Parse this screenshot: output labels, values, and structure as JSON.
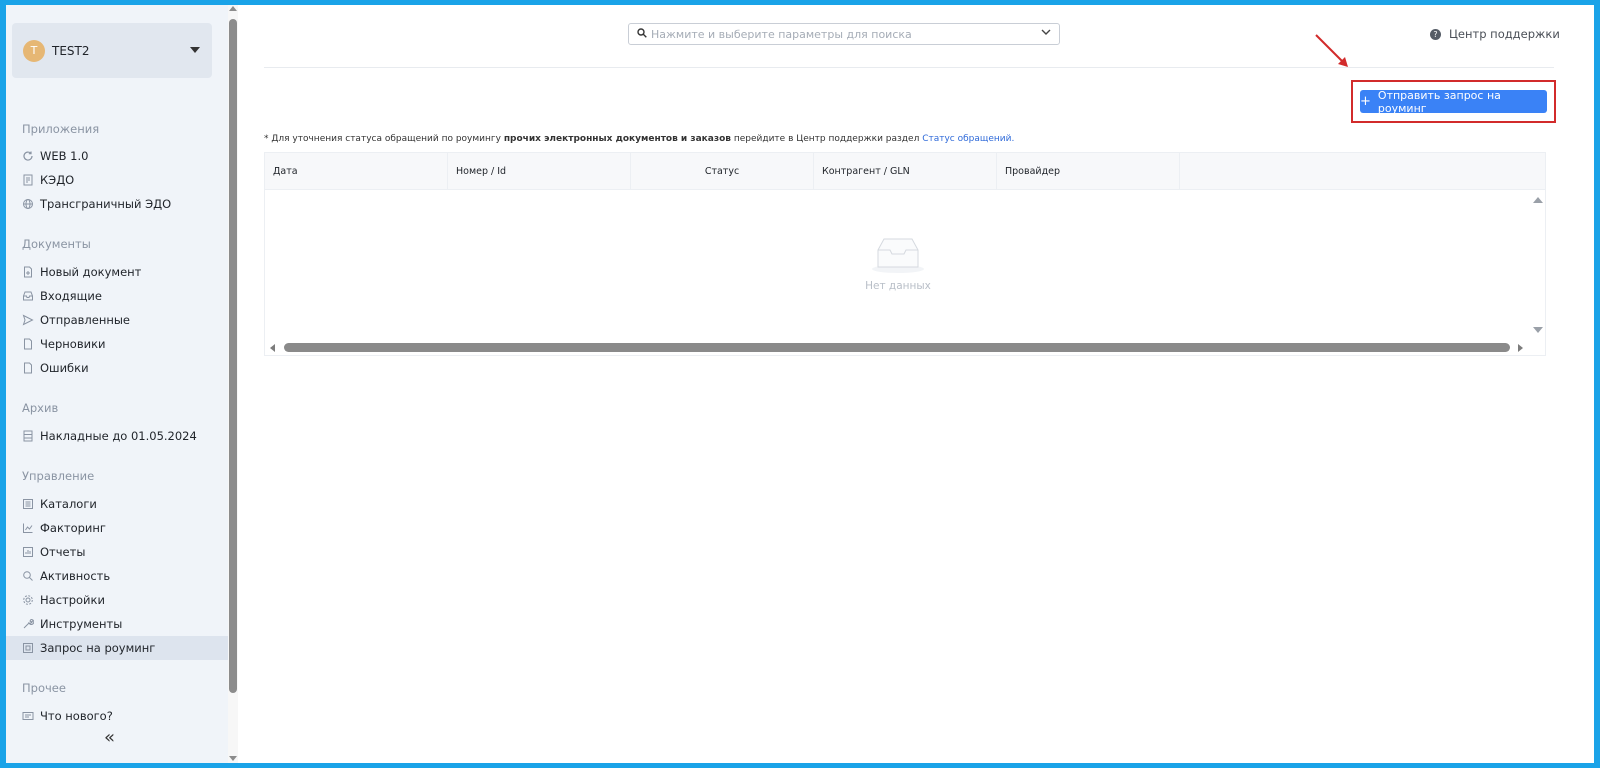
{
  "account": {
    "initial": "T",
    "name": "TEST2",
    "avatar_color": "#e6b774"
  },
  "sidebar": {
    "sections": [
      {
        "title": "Приложения",
        "items": [
          {
            "label": "WEB 1.0",
            "icon": "refresh-icon"
          },
          {
            "label": "КЭДО",
            "icon": "document-grid-icon"
          },
          {
            "label": "Трансграничный ЭДО",
            "icon": "globe-icon"
          }
        ]
      },
      {
        "title": "Документы",
        "items": [
          {
            "label": "Новый документ",
            "icon": "file-plus-icon"
          },
          {
            "label": "Входящие",
            "icon": "inbox-icon"
          },
          {
            "label": "Отправленные",
            "icon": "send-icon"
          },
          {
            "label": "Черновики",
            "icon": "file-icon"
          },
          {
            "label": "Ошибки",
            "icon": "file-error-icon"
          }
        ]
      },
      {
        "title": "Архив",
        "items": [
          {
            "label": "Накладные до 01.05.2024",
            "icon": "archive-icon"
          }
        ]
      },
      {
        "title": "Управление",
        "items": [
          {
            "label": "Каталоги",
            "icon": "catalog-icon"
          },
          {
            "label": "Факторинг",
            "icon": "chart-icon"
          },
          {
            "label": "Отчеты",
            "icon": "report-icon"
          },
          {
            "label": "Активность",
            "icon": "search-icon"
          },
          {
            "label": "Настройки",
            "icon": "gear-icon"
          },
          {
            "label": "Инструменты",
            "icon": "wrench-icon"
          },
          {
            "label": "Запрос на роуминг",
            "icon": "roaming-icon",
            "active": true
          }
        ]
      },
      {
        "title": "Прочее",
        "items": [
          {
            "label": "Что нового?",
            "icon": "news-icon"
          }
        ]
      }
    ],
    "collapse_label": "«"
  },
  "search": {
    "placeholder": "Нажмите и выберите параметры для поиска"
  },
  "support": {
    "label": "Центр поддержки"
  },
  "roaming_button": {
    "label": "Отправить запрос на роуминг",
    "color": "#3a82f6"
  },
  "note": {
    "prefix": "* Для уточнения статуса обращений по роумингу ",
    "bold": "прочих электронных документов и заказов",
    "middle": " перейдите в Центр поддержки раздел ",
    "link": "Статус обращений."
  },
  "table": {
    "columns": [
      "Дата",
      "Номер / Id",
      "Статус",
      "Контрагент / GLN",
      "Провайдер"
    ],
    "empty_text": "Нет данных"
  },
  "highlight_color": "#d22b2b"
}
